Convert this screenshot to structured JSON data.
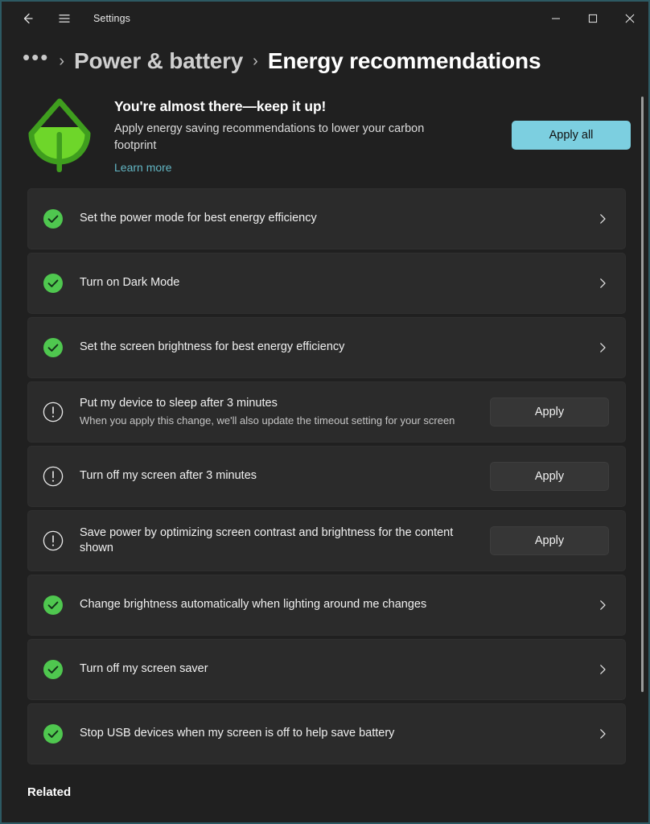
{
  "window": {
    "app_title": "Settings",
    "back_icon": "back-arrow-icon",
    "menu_icon": "hamburger-icon",
    "minimize_icon": "minimize-icon",
    "maximize_icon": "maximize-icon",
    "close_icon": "close-icon"
  },
  "breadcrumb": {
    "overflow": "•••",
    "separator": "›",
    "parent": "Power & battery",
    "current": "Energy recommendations"
  },
  "hero": {
    "icon": "leaf-icon",
    "title": "You're almost there—keep it up!",
    "subtitle": "Apply energy saving recommendations to lower your carbon footprint",
    "link": "Learn more",
    "apply_all_label": "Apply all"
  },
  "recommendations": [
    {
      "status": "done",
      "icon": "check-circle-icon",
      "title": "Set the power mode for best energy efficiency",
      "desc": "",
      "action": "chevron",
      "action_label": "",
      "chevron": "›"
    },
    {
      "status": "done",
      "icon": "check-circle-icon",
      "title": "Turn on Dark Mode",
      "desc": "",
      "action": "chevron",
      "action_label": "",
      "chevron": "›"
    },
    {
      "status": "done",
      "icon": "check-circle-icon",
      "title": "Set the screen brightness for best energy efficiency",
      "desc": "",
      "action": "chevron",
      "action_label": "",
      "chevron": "›"
    },
    {
      "status": "pending",
      "icon": "exclamation-circle-icon",
      "title": "Put my device to sleep after 3 minutes",
      "desc": "When you apply this change, we'll also update the timeout setting for your screen",
      "action": "button",
      "action_label": "Apply",
      "chevron": ""
    },
    {
      "status": "pending",
      "icon": "exclamation-circle-icon",
      "title": "Turn off my screen after 3 minutes",
      "desc": "",
      "action": "button",
      "action_label": "Apply",
      "chevron": ""
    },
    {
      "status": "pending",
      "icon": "exclamation-circle-icon",
      "title": "Save power by optimizing screen contrast and brightness for the content shown",
      "desc": "",
      "action": "button",
      "action_label": "Apply",
      "chevron": ""
    },
    {
      "status": "done",
      "icon": "check-circle-icon",
      "title": "Change brightness automatically when lighting around me changes",
      "desc": "",
      "action": "chevron",
      "action_label": "",
      "chevron": "›"
    },
    {
      "status": "done",
      "icon": "check-circle-icon",
      "title": "Turn off my screen saver",
      "desc": "",
      "action": "chevron",
      "action_label": "",
      "chevron": "›"
    },
    {
      "status": "done",
      "icon": "check-circle-icon",
      "title": "Stop USB devices when my screen is off to help save battery",
      "desc": "",
      "action": "chevron",
      "action_label": "",
      "chevron": "›"
    }
  ],
  "related": {
    "heading": "Related"
  },
  "colors": {
    "accent_button": "#7ccfe0",
    "link": "#62b6c4",
    "status_done": "#4fc74f",
    "leaf_outline": "#3f9e1e",
    "leaf_fill": "#6ed62a",
    "page_background": "#202020",
    "card_background": "#2b2b2b",
    "window_border": "#2d5a63"
  }
}
